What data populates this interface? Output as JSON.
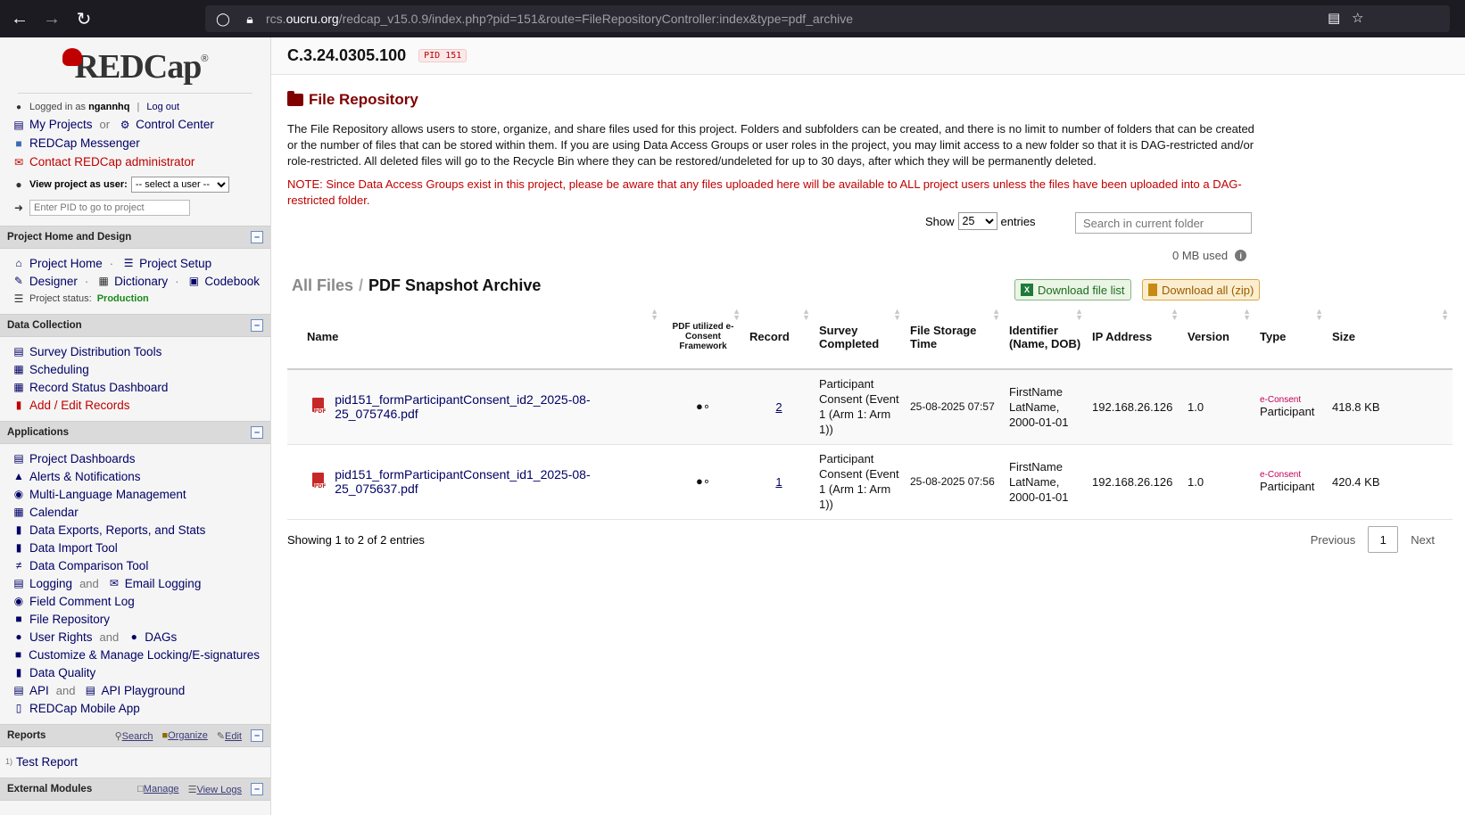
{
  "browser": {
    "url_prefix": "rcs.",
    "url_domain": "oucru.org",
    "url_rest": "/redcap_v15.0.9/index.php?pid=151&route=FileRepositoryController:index&type=pdf_archive"
  },
  "sidebar": {
    "logo_text": "REDCap",
    "logged_in_label": "Logged in as",
    "username": "ngannhq",
    "logout": "Log out",
    "my_projects": "My Projects",
    "or_text": "or",
    "control_center": "Control Center",
    "messenger": "REDCap Messenger",
    "contact_admin": "Contact REDCap administrator",
    "view_as_label": "View project as user:",
    "view_as_value": "-- select a user --",
    "pid_placeholder": "Enter PID to go to project",
    "sections": {
      "home_design": {
        "title": "Project Home and Design",
        "project_home": "Project Home",
        "project_setup": "Project Setup",
        "designer": "Designer",
        "dictionary": "Dictionary",
        "codebook": "Codebook",
        "status_label": "Project status:",
        "status_value": "Production"
      },
      "data_collection": {
        "title": "Data Collection",
        "items": [
          "Survey Distribution Tools",
          "Scheduling",
          "Record Status Dashboard",
          "Add / Edit Records"
        ]
      },
      "applications": {
        "title": "Applications",
        "project_dashboards": "Project Dashboards",
        "alerts": "Alerts & Notifications",
        "multilang": "Multi-Language Management",
        "calendar": "Calendar",
        "exports": "Data Exports, Reports, and Stats",
        "import": "Data Import Tool",
        "comparison": "Data Comparison Tool",
        "logging": "Logging",
        "and": "and",
        "email_logging": "Email Logging",
        "field_comment": "Field Comment Log",
        "file_repo": "File Repository",
        "user_rights": "User Rights",
        "dags": "DAGs",
        "locking": "Customize & Manage Locking/E-signatures",
        "data_quality": "Data Quality",
        "api": "API",
        "api_playground": "API Playground",
        "mobile_app": "REDCap Mobile App"
      },
      "reports": {
        "title": "Reports",
        "search": "Search",
        "organize": "Organize",
        "edit": "Edit",
        "item_num": "1)",
        "item": "Test Report"
      },
      "external_modules": {
        "title": "External Modules",
        "manage": "Manage",
        "view_logs": "View Logs"
      }
    }
  },
  "header": {
    "project_title": "C.3.24.0305.100",
    "pid_badge": "PID 151"
  },
  "main": {
    "page_title": "File Repository",
    "intro": "The File Repository allows users to store, organize, and share files used for this project. Folders and subfolders can be created, and there is no limit to number of folders that can be created or the number of files that can be stored within them. If you are using Data Access Groups or user roles in the project, you may limit access to a new folder so that it is DAG-restricted and/or role-restricted. All deleted files will go to the Recycle Bin where they can be restored/undeleted for up to 30 days, after which they will be permanently deleted.",
    "note": "NOTE: Since Data Access Groups exist in this project, please be aware that any files uploaded here will be available to ALL project users unless the files have been uploaded into a DAG-restricted folder.",
    "show_label": "Show",
    "entries_value": "25",
    "entries_label": "entries",
    "search_placeholder": "Search in current folder",
    "usage": "0 MB used",
    "breadcrumb_all": "All Files",
    "breadcrumb_sep": "/",
    "breadcrumb_current": "PDF Snapshot Archive",
    "download_list": "Download file list",
    "download_zip": "Download all (zip)",
    "columns": {
      "name": "Name",
      "pdf_framework": "PDF utilized e-Consent Framework",
      "record": "Record",
      "survey_completed": "Survey Completed",
      "storage_time": "File Storage Time",
      "identifier": "Identifier (Name, DOB)",
      "ip": "IP Address",
      "version": "Version",
      "type": "Type",
      "size": "Size"
    },
    "rows": [
      {
        "name": "pid151_formParticipantConsent_id2_2025-08-25_075746.pdf",
        "record": "2",
        "survey": "Participant Consent (Event 1 (Arm 1: Arm 1))",
        "time": "25-08-2025 07:57",
        "identifier": "FirstName LatName, 2000-01-01",
        "ip": "192.168.26.126",
        "version": "1.0",
        "type_tag": "e-Consent",
        "type": "Participant",
        "size": "418.8 KB"
      },
      {
        "name": "pid151_formParticipantConsent_id1_2025-08-25_075637.pdf",
        "record": "1",
        "survey": "Participant Consent (Event 1 (Arm 1: Arm 1))",
        "time": "25-08-2025 07:56",
        "identifier": "FirstName LatName, 2000-01-01",
        "ip": "192.168.26.126",
        "version": "1.0",
        "type_tag": "e-Consent",
        "type": "Participant",
        "size": "420.4 KB"
      }
    ],
    "showing": "Showing 1 to 2 of 2 entries",
    "prev": "Previous",
    "page": "1",
    "next": "Next"
  }
}
